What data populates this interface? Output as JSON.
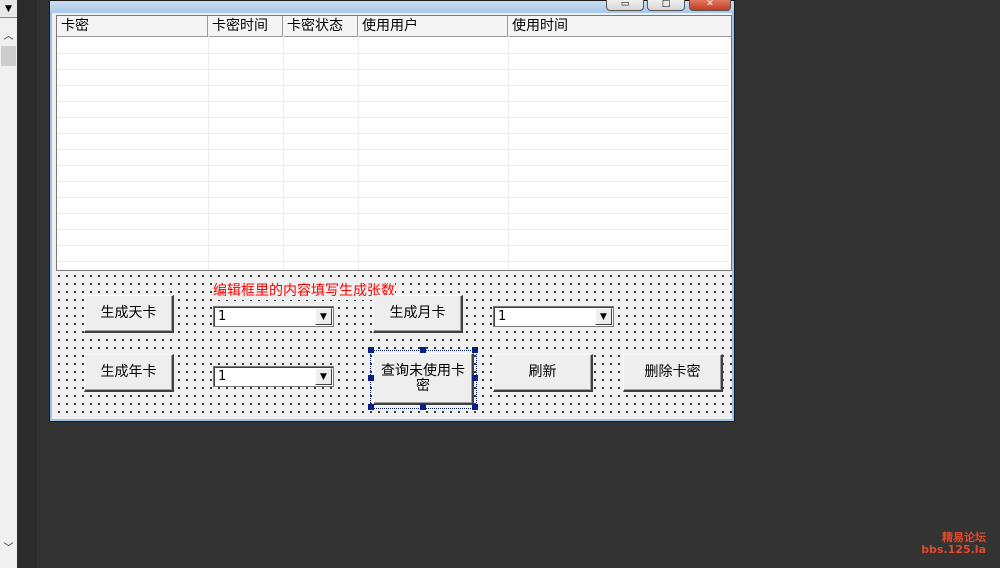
{
  "list": {
    "columns": [
      "卡密",
      "卡密时间",
      "卡密状态",
      "使用用户",
      "使用时间"
    ]
  },
  "hint_label": "编辑框里的内容填写生成张数",
  "buttons": {
    "gen_day": "生成天卡",
    "gen_month": "生成月卡",
    "gen_year": "生成年卡",
    "query_unused": "查询未使用卡密",
    "refresh": "刷新",
    "delete": "删除卡密"
  },
  "combos": {
    "day_count": "1",
    "month_count": "1",
    "year_count": "1"
  },
  "watermark": {
    "line1": "精易论坛",
    "line2": "bbs.125.la"
  },
  "icons": {
    "combo_arrow": "chevron-down-icon",
    "scroll_up": "chevron-up-icon",
    "scroll_down": "chevron-down-icon"
  }
}
